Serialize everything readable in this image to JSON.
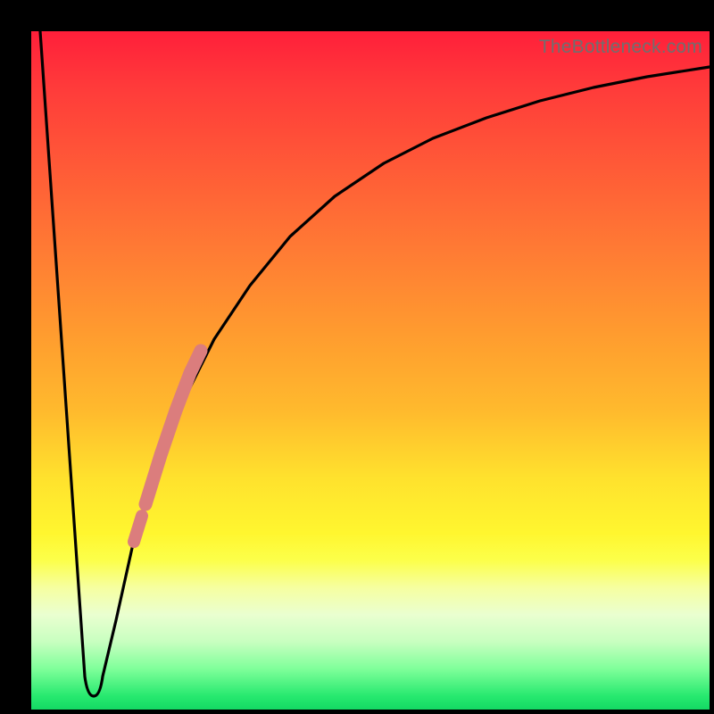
{
  "watermark": "TheBottleneck.com",
  "colors": {
    "frame": "#000000",
    "curve": "#000000",
    "highlight": "#db7d7d",
    "watermark": "#6f6f6f"
  },
  "chart_data": {
    "type": "line",
    "title": "",
    "xlabel": "",
    "ylabel": "",
    "xlim": [
      0,
      100
    ],
    "ylim": [
      0,
      100
    ],
    "grid": false,
    "legend": false,
    "series": [
      {
        "name": "curve",
        "x": [
          0,
          2,
          4,
          5,
          6,
          7,
          8,
          9,
          10,
          12,
          14,
          16,
          18,
          20,
          22,
          25,
          30,
          35,
          40,
          45,
          50,
          55,
          60,
          65,
          70,
          75,
          80,
          85,
          90,
          95,
          100
        ],
        "values": [
          100,
          70,
          40,
          25,
          10,
          3,
          0,
          0,
          3,
          12,
          22,
          32,
          41,
          48,
          54,
          60,
          69,
          75,
          80,
          83.5,
          86,
          88,
          89.5,
          91,
          92,
          93,
          93.8,
          94.5,
          95.1,
          95.6,
          96
        ]
      }
    ],
    "highlight_segment": {
      "x_start": 14,
      "x_end": 20,
      "note": "salmon-colored thick overlay on rising branch"
    }
  }
}
